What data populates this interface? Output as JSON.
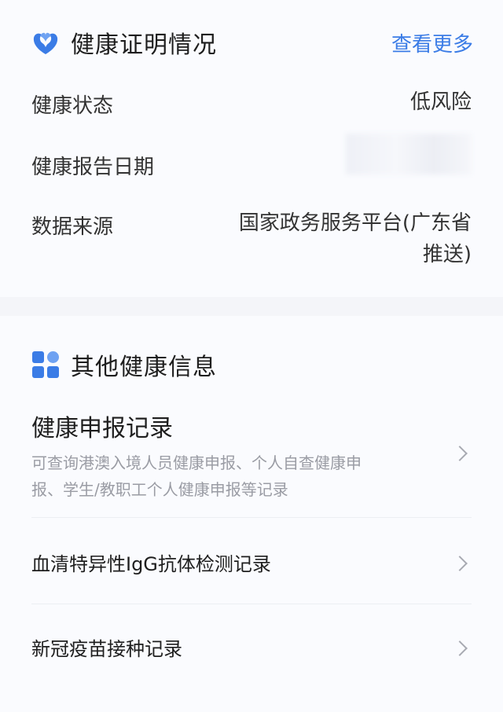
{
  "health_card": {
    "title": "健康证明情况",
    "more_label": "查看更多",
    "icon": "heart-leaf-icon",
    "rows": [
      {
        "label": "健康状态",
        "value": "低风险"
      },
      {
        "label": "健康报告日期",
        "value": ""
      },
      {
        "label": "数据来源",
        "value_line1": "国家政务服务平台(广东省",
        "value_line2": "推送)"
      }
    ]
  },
  "other_info": {
    "title": "其他健康信息",
    "icon": "grid-blocks-icon",
    "items": [
      {
        "title": "健康申报记录",
        "desc_line1": "可查询港澳入境人员健康申报、个人自查健康申",
        "desc_line2": "报、学生/教职工个人健康申报等记录"
      },
      {
        "title": "血清特异性IgG抗体检测记录"
      },
      {
        "title": "新冠疫苗接种记录"
      }
    ]
  },
  "colors": {
    "accent": "#3b7ce6",
    "page_bg": "#f4f5f9",
    "card_bg": "#fafbfe"
  }
}
